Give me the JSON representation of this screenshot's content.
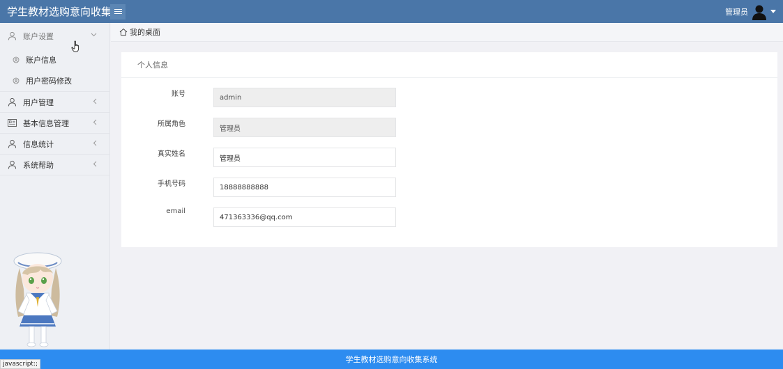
{
  "header": {
    "app_title": "学生教材选购意向收集系",
    "user_name": "管理员"
  },
  "sidebar": {
    "items": [
      {
        "label": "账户设置",
        "expanded": true
      },
      {
        "label": "账户信息"
      },
      {
        "label": "用户密码修改"
      },
      {
        "label": "用户管理"
      },
      {
        "label": "基本信息管理"
      },
      {
        "label": "信息统计"
      },
      {
        "label": "系统帮助"
      }
    ]
  },
  "breadcrumb": {
    "home_label": "我的桌面"
  },
  "panel": {
    "title": "个人信息",
    "fields": [
      {
        "label": "账号",
        "value": "admin",
        "readonly": true
      },
      {
        "label": "所属角色",
        "value": "管理员",
        "readonly": true
      },
      {
        "label": "真实姓名",
        "value": "管理员",
        "readonly": false
      },
      {
        "label": "手机号码",
        "value": "18888888888",
        "readonly": false
      },
      {
        "label": "email",
        "value": "471363336@qq.com",
        "readonly": false
      }
    ]
  },
  "footer": {
    "text": "学生教材选购意向收集系统"
  },
  "statusbar": {
    "text": "javascript:;"
  },
  "colors": {
    "header_bg": "#4a76a8",
    "footer_bg": "#2d8cf0",
    "sidebar_bg": "#eef0f4"
  }
}
